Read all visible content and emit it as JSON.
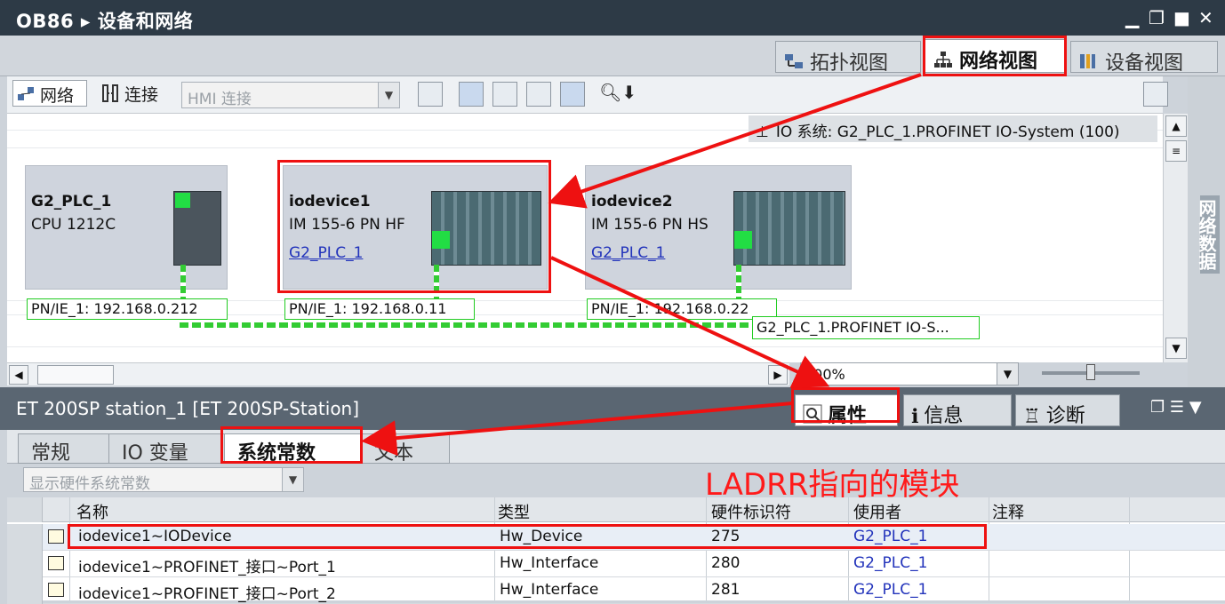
{
  "titlebar": {
    "text": "OB86 ▸ 设备和网络"
  },
  "view_tabs": [
    {
      "label": "拓扑视图"
    },
    {
      "label": "网络视图",
      "active": true
    },
    {
      "label": "设备视图"
    }
  ],
  "toolbar": {
    "network_label": "网络",
    "connect_label": "连接",
    "hmi_placeholder": "HMI 连接"
  },
  "io_system": {
    "label": "IO 系统: G2_PLC_1.PROFINET IO-System (100)"
  },
  "devices": [
    {
      "name": "G2_PLC_1",
      "model": "CPU 1212C",
      "link": "",
      "ip": "PN/IE_1:  192.168.0.212"
    },
    {
      "name": "iodevice1",
      "model": "IM 155-6 PN HF",
      "link": "G2_PLC_1",
      "ip": "PN/IE_1:  192.168.0.11"
    },
    {
      "name": "iodevice2",
      "model": "IM 155-6 PN HS",
      "link": "G2_PLC_1",
      "ip": "PN/IE_1:  192.168.0.22"
    }
  ],
  "network_label": "G2_PLC_1.PROFINET IO-S...",
  "zoom": "100%",
  "side_panel": "网络数据",
  "inspector": {
    "title": "ET 200SP station_1 [ET 200SP-Station]",
    "tabs": [
      {
        "label": "属性",
        "active": true
      },
      {
        "label": "信息"
      },
      {
        "label": "诊断"
      }
    ]
  },
  "sub_tabs": [
    {
      "label": "常规"
    },
    {
      "label": "IO 变量"
    },
    {
      "label": "系统常数",
      "active": true
    },
    {
      "label": "文本"
    }
  ],
  "filter": {
    "value": "显示硬件系统常数"
  },
  "annotation": "LADRR指向的模块",
  "table": {
    "headers": [
      "名称",
      "类型",
      "硬件标识符",
      "使用者",
      "注释"
    ],
    "rows": [
      {
        "name": "iodevice1~IODevice",
        "type": "Hw_Device",
        "hwid": "275",
        "user": "G2_PLC_1",
        "comment": ""
      },
      {
        "name": "iodevice1~PROFINET_接口~Port_1",
        "type": "Hw_Interface",
        "hwid": "280",
        "user": "G2_PLC_1",
        "comment": ""
      },
      {
        "name": "iodevice1~PROFINET_接口~Port_2",
        "type": "Hw_Interface",
        "hwid": "281",
        "user": "G2_PLC_1",
        "comment": ""
      }
    ]
  },
  "colors": {
    "highlight": "#ee1111",
    "network": "#33cc33",
    "link": "#2233bb"
  }
}
